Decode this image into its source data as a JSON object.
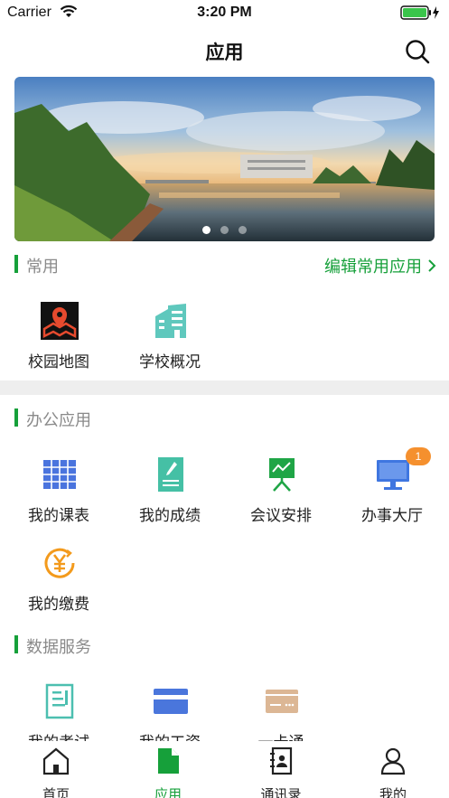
{
  "status_bar": {
    "carrier": "Carrier",
    "time": "3:20 PM"
  },
  "nav": {
    "title": "应用"
  },
  "banner": {
    "page_count": 3,
    "active_page": 1
  },
  "sections": {
    "common": {
      "title": "常用",
      "action": "编辑常用应用",
      "apps": [
        {
          "label": "校园地图",
          "icon": "map-pin-icon"
        },
        {
          "label": "学校概况",
          "icon": "buildings-icon"
        }
      ]
    },
    "office": {
      "title": "办公应用",
      "apps": [
        {
          "label": "我的课表",
          "icon": "calendar-grid-icon"
        },
        {
          "label": "我的成绩",
          "icon": "notepad-pencil-icon"
        },
        {
          "label": "会议安排",
          "icon": "presentation-board-icon"
        },
        {
          "label": "办事大厅",
          "icon": "monitor-icon",
          "badge": "1"
        },
        {
          "label": "我的缴费",
          "icon": "yuan-coin-icon"
        }
      ]
    },
    "data": {
      "title": "数据服务",
      "apps": [
        {
          "label": "我的考试",
          "icon": "exam-paper-icon"
        },
        {
          "label": "我的工资",
          "icon": "bank-card-icon"
        },
        {
          "label": "一卡通",
          "icon": "campus-card-icon"
        }
      ]
    }
  },
  "tabs": [
    {
      "label": "首页",
      "icon": "home-icon"
    },
    {
      "label": "应用",
      "icon": "document-icon",
      "active": true
    },
    {
      "label": "通讯录",
      "icon": "contacts-book-icon"
    },
    {
      "label": "我的",
      "icon": "person-icon"
    }
  ],
  "colors": {
    "accent": "#16a03a",
    "badge": "#f5902e",
    "section_label": "#8a8a8a"
  }
}
